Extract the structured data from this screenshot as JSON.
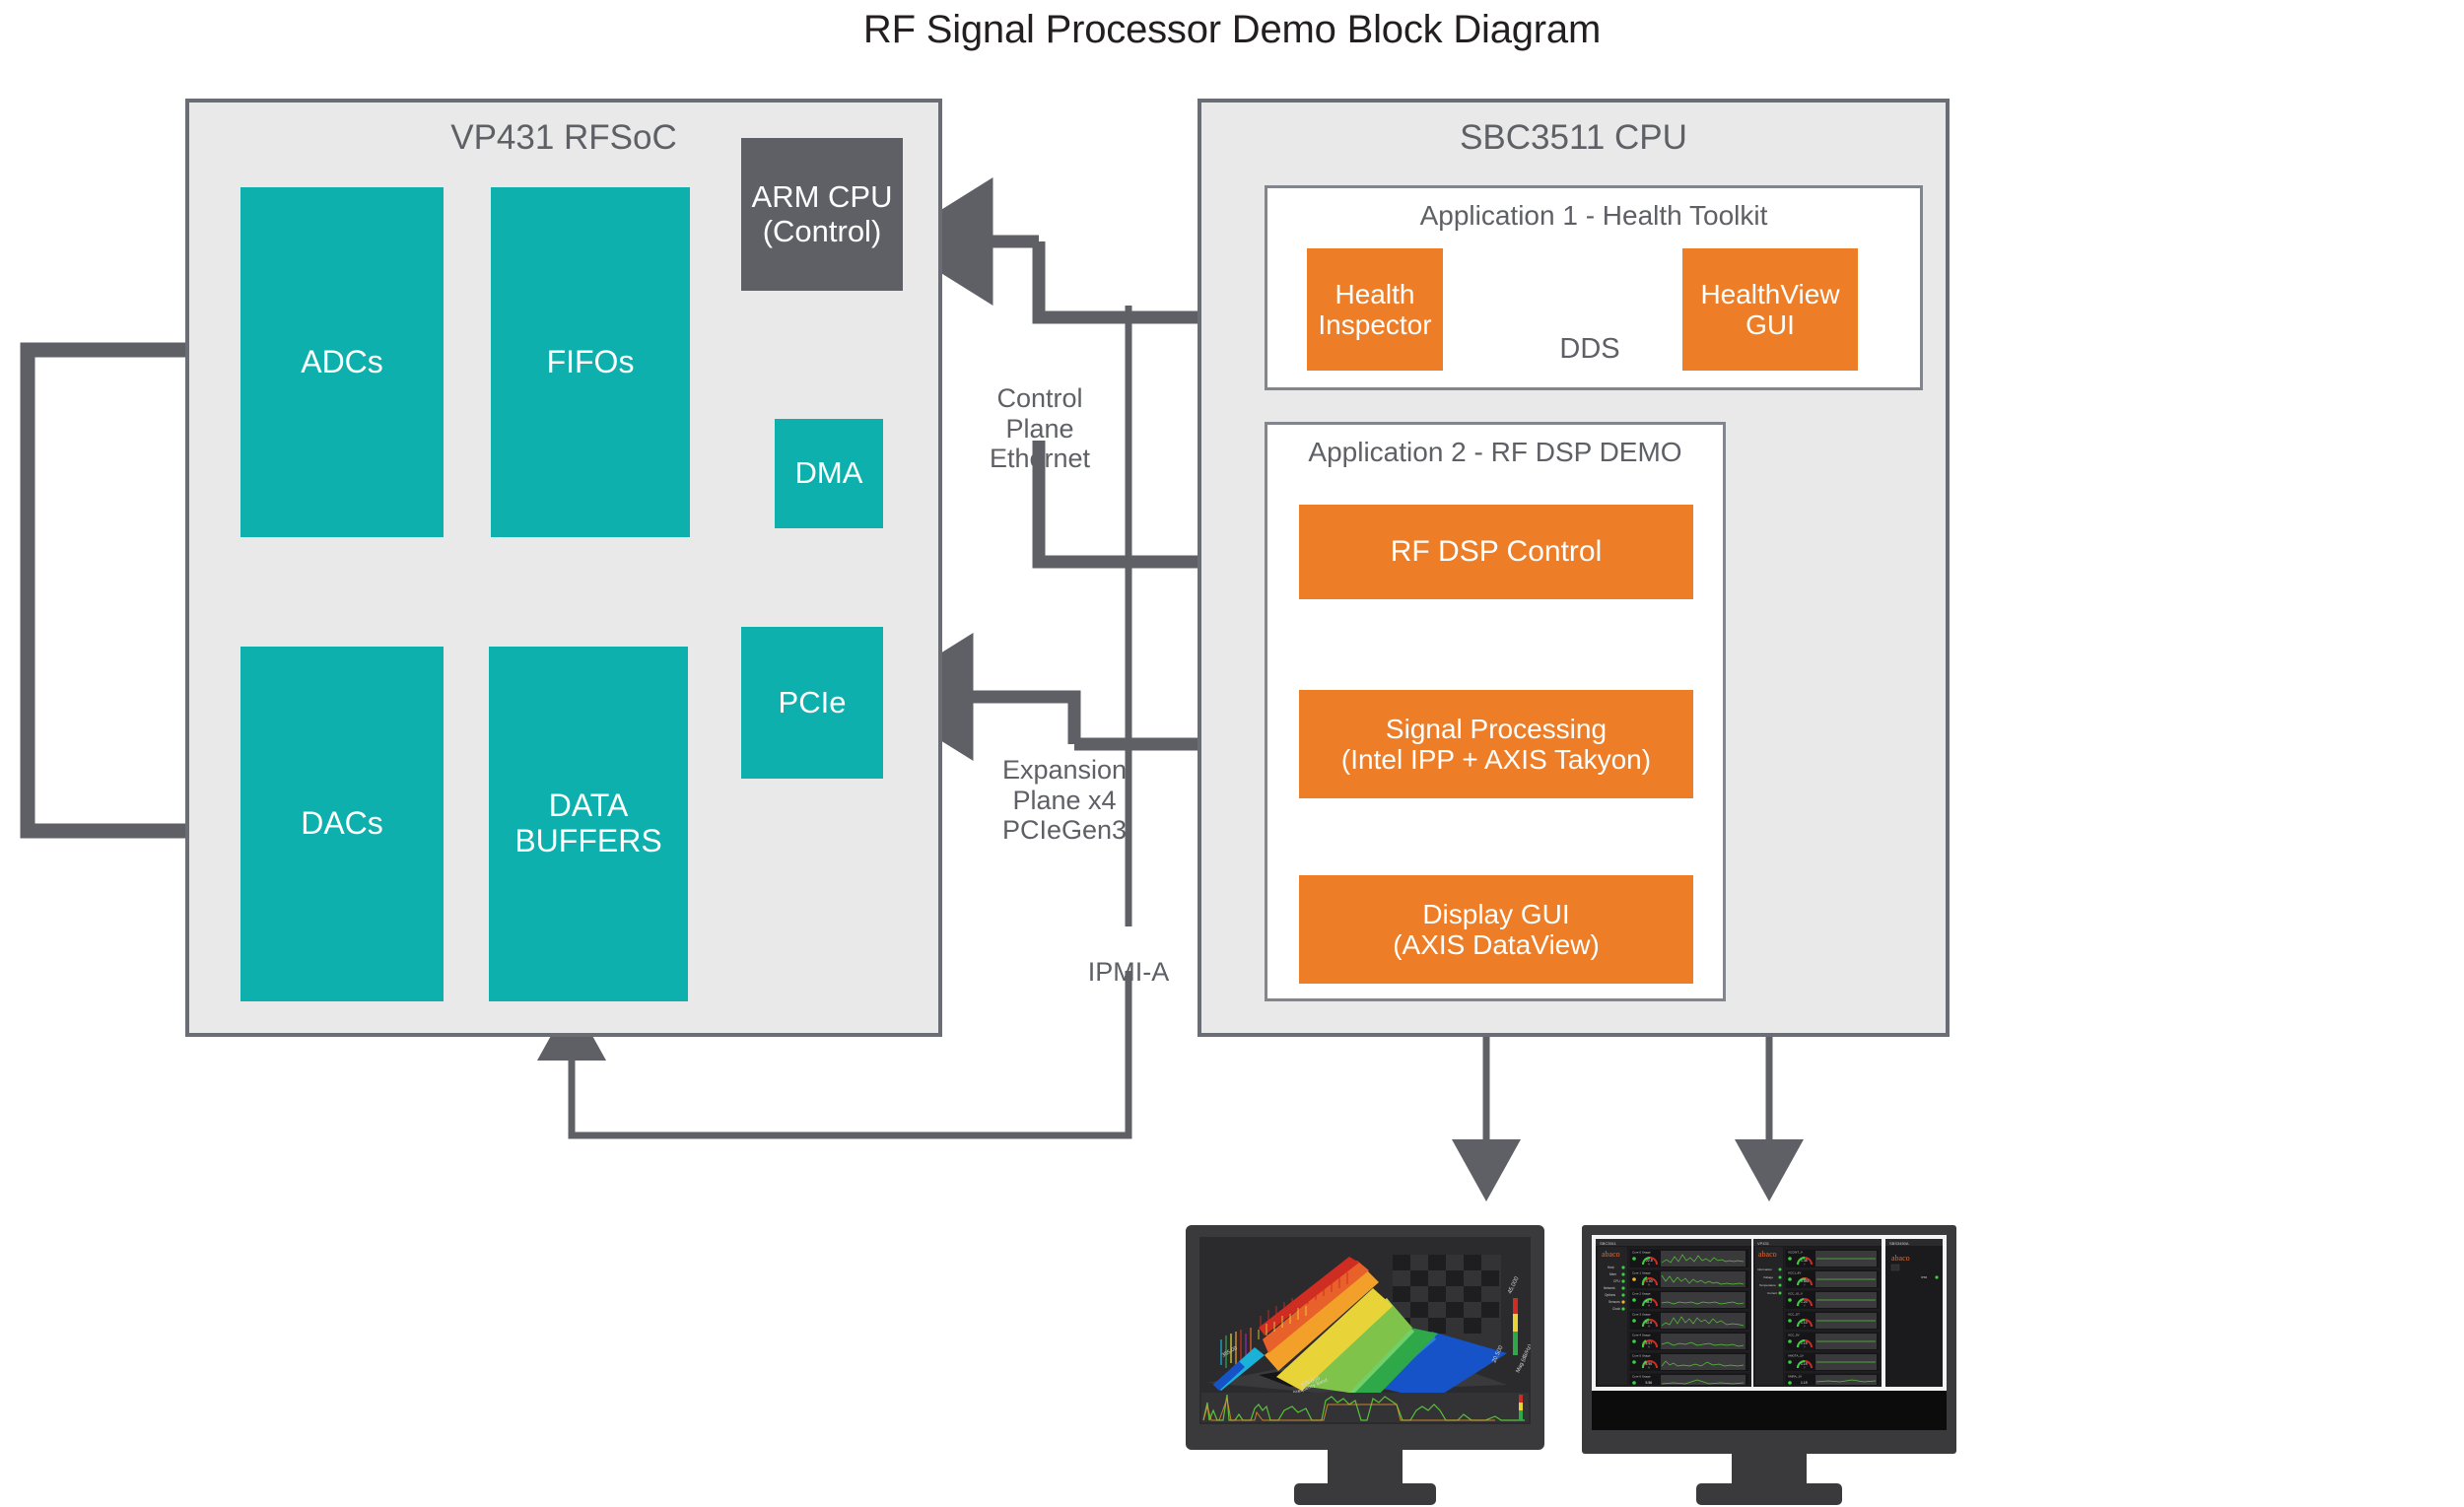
{
  "title": "RF Signal Processor Demo Block Diagram",
  "colors": {
    "teal": "#0db0ad",
    "orange": "#ed7d26",
    "grey_block": "#5e6066",
    "panel_fill": "#e9e9e9",
    "panel_stroke": "#6b6d74",
    "wire": "#5e6066",
    "text_dark": "#231f20"
  },
  "fpga_panel": {
    "title": "VP431 RFSoC",
    "blocks": [
      {
        "id": "adcs",
        "label": "ADCs",
        "color": "teal"
      },
      {
        "id": "fifos",
        "label": "FIFOs",
        "color": "teal"
      },
      {
        "id": "arm_cpu",
        "label": "ARM CPU\n(Control)",
        "color": "grey"
      },
      {
        "id": "dma",
        "label": "DMA",
        "color": "teal"
      },
      {
        "id": "pcie",
        "label": "PCIe",
        "color": "teal"
      },
      {
        "id": "dacs",
        "label": "DACs",
        "color": "teal"
      },
      {
        "id": "data_buffers",
        "label": "DATA\nBUFFERS",
        "color": "teal"
      }
    ]
  },
  "cpu_panel": {
    "title": "SBC3511 CPU",
    "app1": {
      "title": "Application 1 - Health Toolkit",
      "blocks": [
        {
          "id": "health_inspector",
          "label": "Health\nInspector",
          "color": "orange"
        },
        {
          "id": "healthview_gui",
          "label": "HealthView\nGUI",
          "color": "orange"
        }
      ],
      "link_label": "DDS"
    },
    "app2": {
      "title": "Application 2 - RF DSP DEMO",
      "blocks": [
        {
          "id": "rf_dsp_control",
          "label": "RF DSP Control",
          "color": "orange"
        },
        {
          "id": "signal_processing",
          "label": "Signal Processing\n(Intel IPP + AXIS Takyon)",
          "color": "orange"
        },
        {
          "id": "display_gui",
          "label": "Display GUI\n(AXIS DataView)",
          "color": "orange"
        }
      ]
    }
  },
  "interconnect_labels": [
    {
      "id": "control_plane",
      "text": "Control\nPlane\nEthernet"
    },
    {
      "id": "expansion_plane",
      "text": "Expansion\nPlane x4\nPCIeGen3"
    },
    {
      "id": "ipmi_a",
      "text": "IPMI-A"
    }
  ],
  "monitors": [
    {
      "id": "dataview_monitor",
      "caption": ""
    },
    {
      "id": "healthview_monitor",
      "caption": ""
    }
  ]
}
